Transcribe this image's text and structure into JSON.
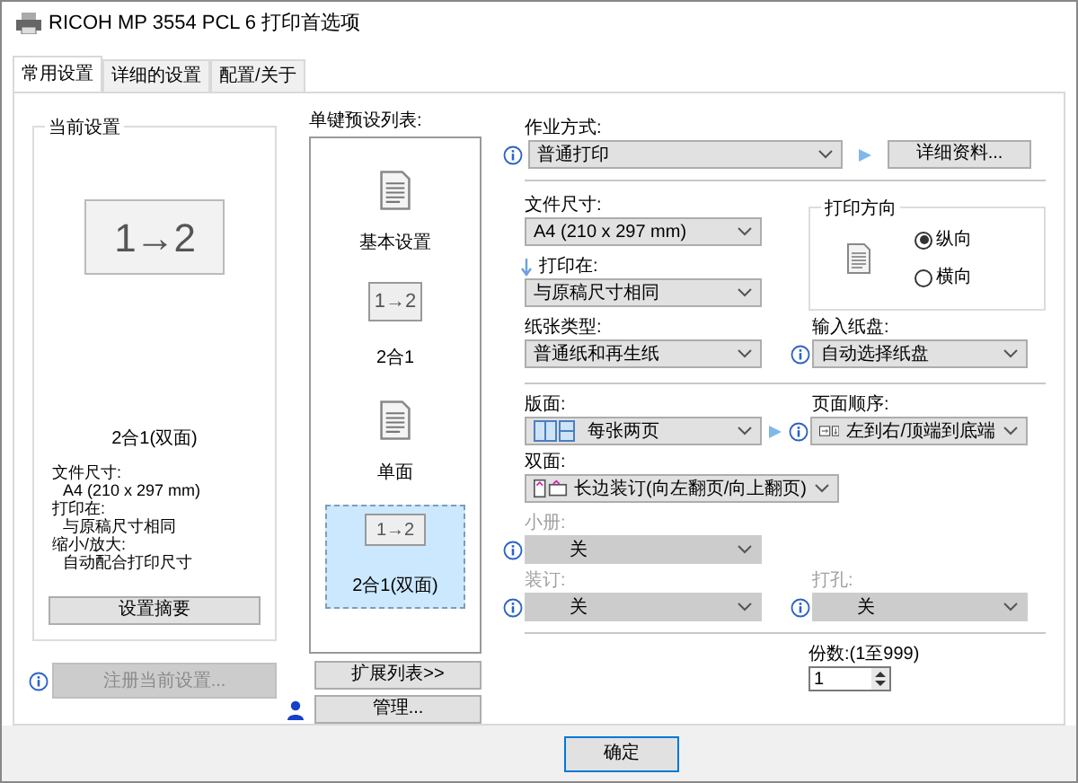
{
  "window": {
    "title": "RICOH MP 3554 PCL 6 打印首选项"
  },
  "tabs": [
    {
      "label": "常用设置",
      "selected": true
    },
    {
      "label": "详细的设置",
      "selected": false
    },
    {
      "label": "配置/关于",
      "selected": false
    }
  ],
  "current_settings": {
    "title": "当前设置",
    "preview_text": "1→2",
    "preview_label": "2合1(双面)",
    "details": [
      {
        "label": "文件尺寸:",
        "value": "A4 (210 x 297 mm)"
      },
      {
        "label": "打印在:",
        "value": "与原稿尺寸相同"
      },
      {
        "label": "缩小/放大:",
        "value": "自动配合打印尺寸"
      }
    ],
    "summary_button": "设置摘要"
  },
  "register_button": {
    "label": "注册当前设置...",
    "disabled": true
  },
  "presets": {
    "title": "单键预设列表:",
    "items": [
      {
        "kind": "document",
        "label": "基本设置",
        "selected": false
      },
      {
        "kind": "pages",
        "icon_text": "1→2",
        "label": "2合1",
        "selected": false
      },
      {
        "kind": "document",
        "label": "单面",
        "selected": false
      },
      {
        "kind": "pages",
        "icon_text": "1→2",
        "label": "2合1(双面)",
        "selected": true
      }
    ],
    "expand_button": "扩展列表>>",
    "manage_button": "管理..."
  },
  "job_type": {
    "label": "作业方式:",
    "value": "普通打印",
    "disabled": false
  },
  "details_button": "详细资料...",
  "paper_size": {
    "label": "文件尺寸:",
    "value": "A4 (210 x 297 mm)",
    "disabled": false
  },
  "print_on": {
    "label": "打印在:",
    "value": "与原稿尺寸相同",
    "disabled": false
  },
  "orientation": {
    "title": "打印方向",
    "options": [
      {
        "label": "纵向",
        "selected": true
      },
      {
        "label": "横向",
        "selected": false
      }
    ]
  },
  "paper_type": {
    "label": "纸张类型:",
    "value": "普通纸和再生纸",
    "disabled": false
  },
  "input_tray": {
    "label": "输入纸盘:",
    "value": "自动选择纸盘",
    "disabled": false
  },
  "layout": {
    "label": "版面:",
    "value": "每张两页",
    "disabled": false
  },
  "page_order": {
    "label": "页面顺序:",
    "value": "左到右/顶端到底端",
    "disabled": false
  },
  "duplex": {
    "label": "双面:",
    "value": "长边装订(向左翻页/向上翻页)",
    "disabled": false
  },
  "booklet": {
    "label": "小册:",
    "value": "关",
    "disabled": true
  },
  "staple": {
    "label": "装订:",
    "value": "关",
    "disabled": true
  },
  "punch": {
    "label": "打孔:",
    "value": "关",
    "disabled": true
  },
  "copies": {
    "label": "份数:(1至999)",
    "value": "1"
  },
  "buttons": [
    "确定"
  ]
}
